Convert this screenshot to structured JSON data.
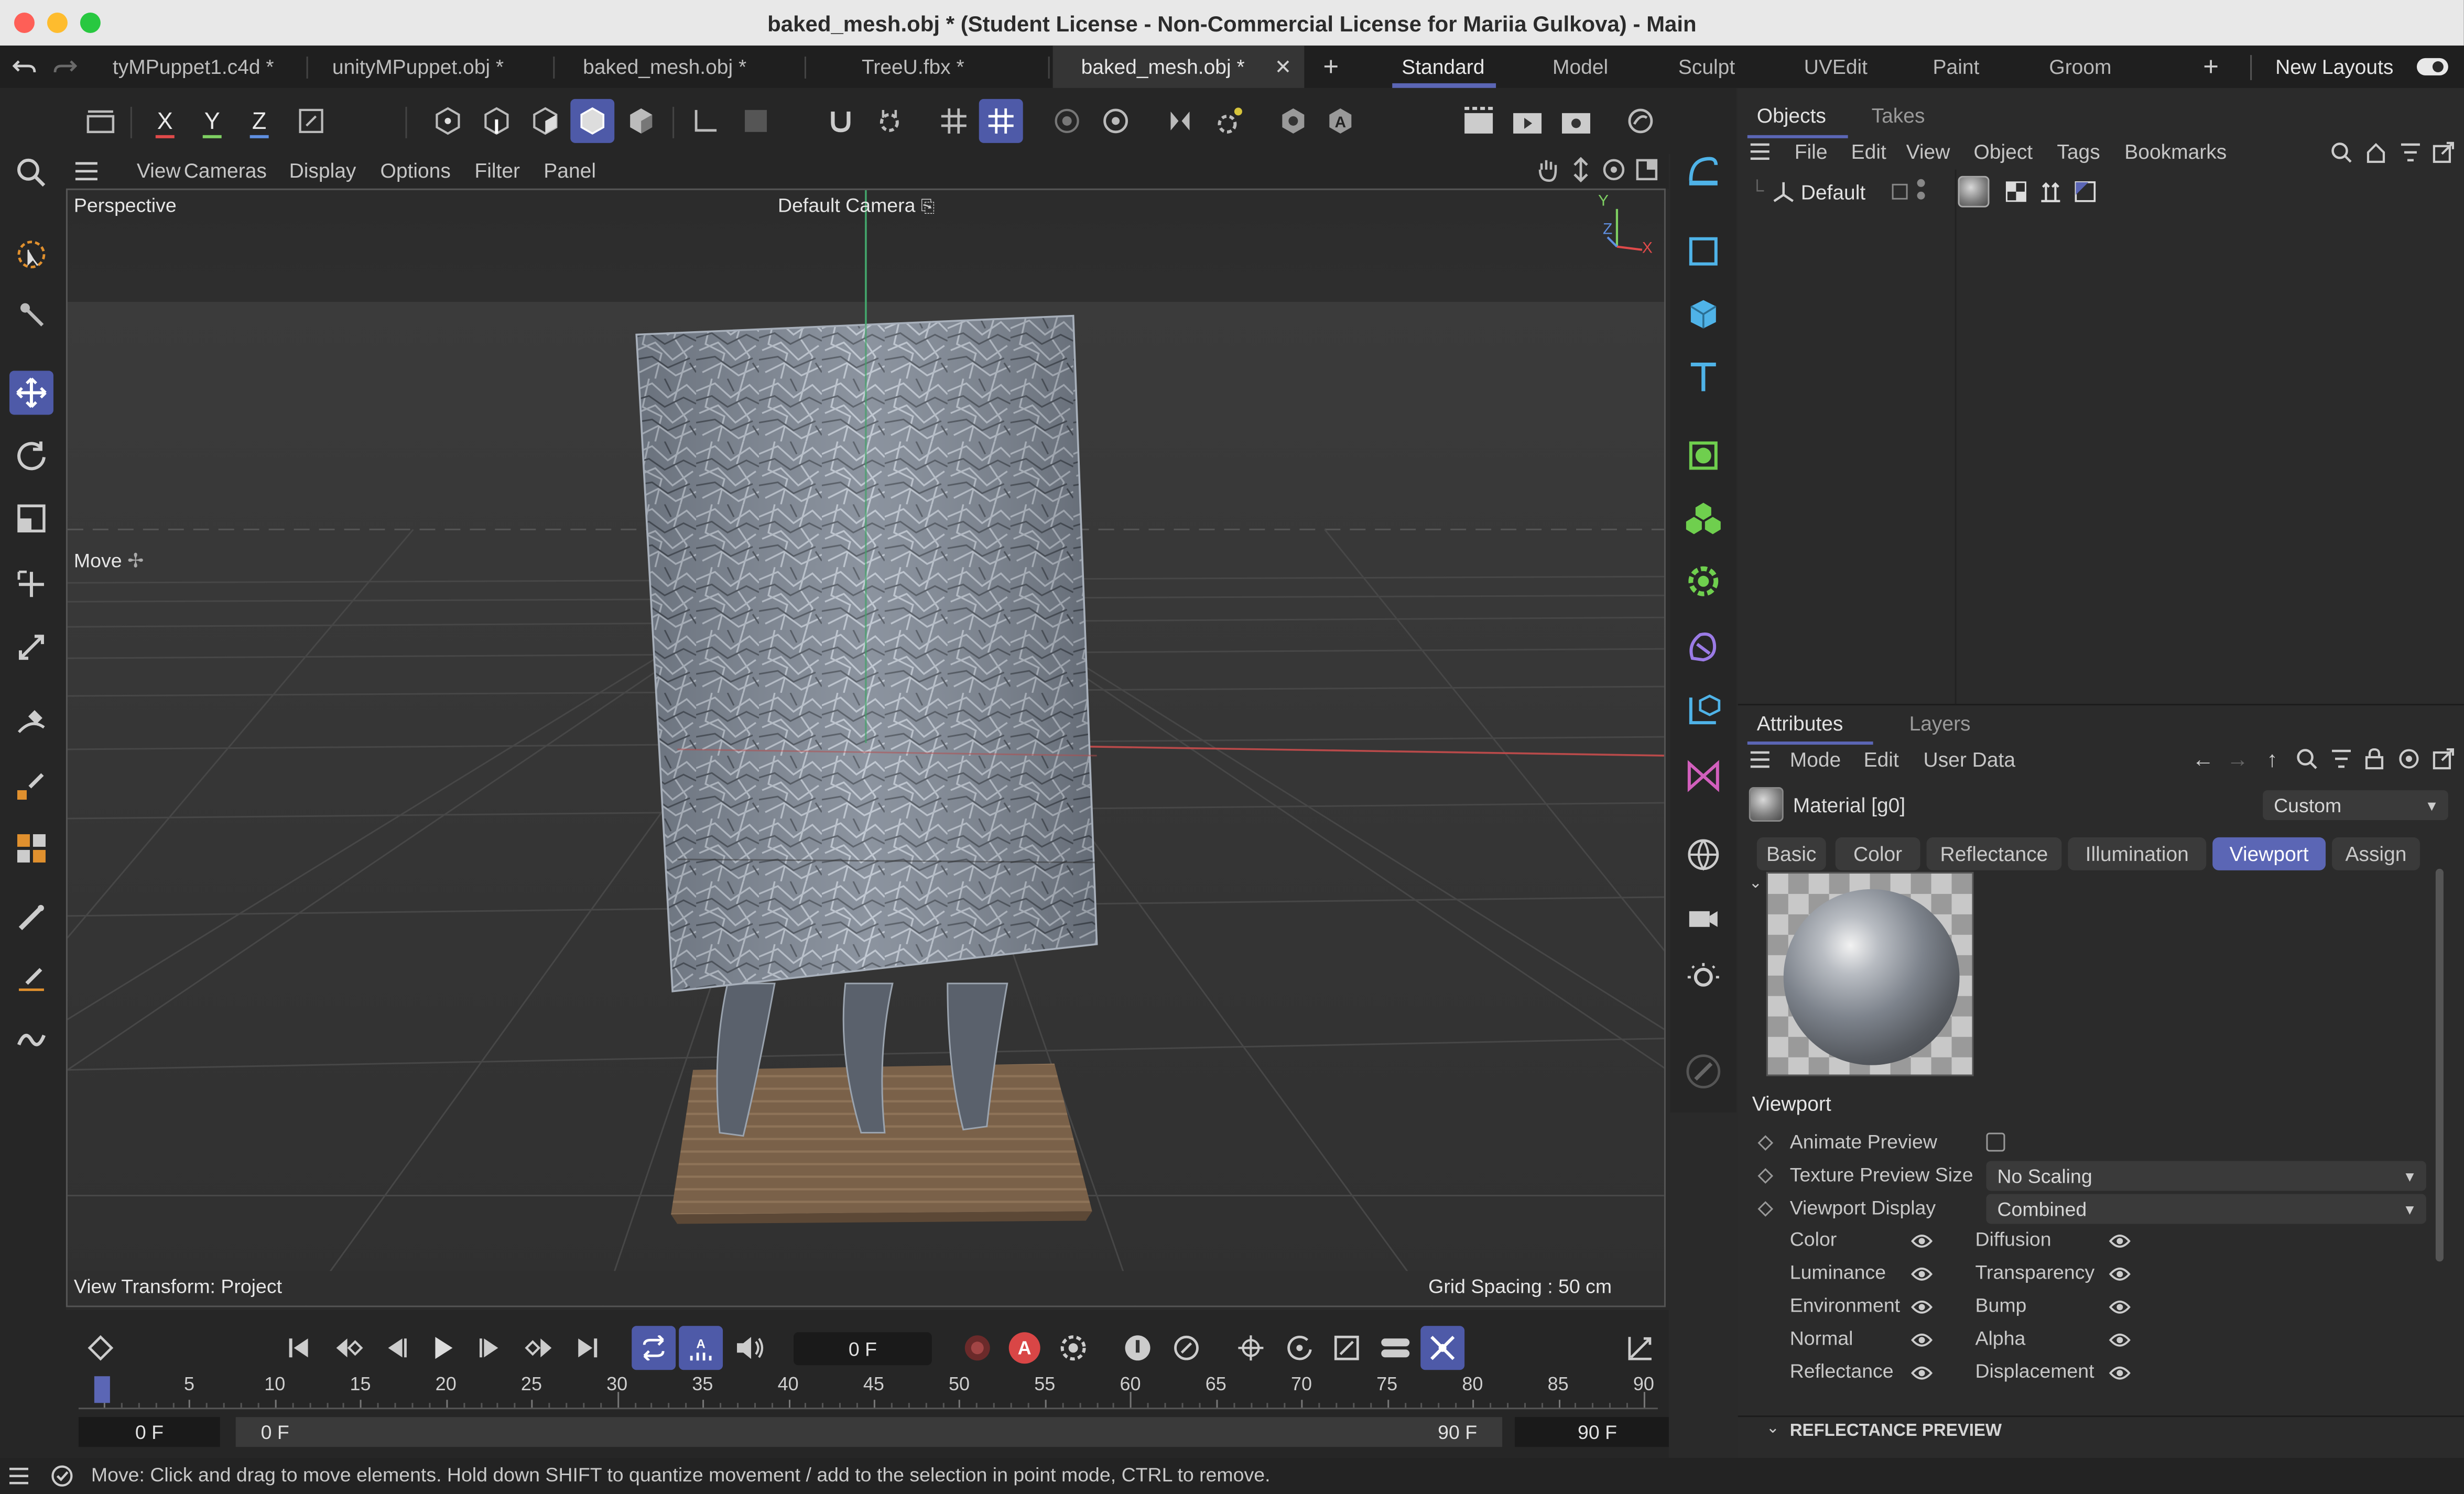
{
  "window": {
    "title": "baked_mesh.obj * (Student License - Non-Commercial License for Mariia Gulkova) - Main"
  },
  "doc_tabs": [
    {
      "label": "tyMPuppet1.c4d *",
      "active": false
    },
    {
      "label": "unityMPuppet.obj *",
      "active": false
    },
    {
      "label": "baked_mesh.obj *",
      "active": false
    },
    {
      "label": "TreeU.fbx *",
      "active": false
    },
    {
      "label": "baked_mesh.obj *",
      "active": true
    }
  ],
  "layouts": {
    "items": [
      "Standard",
      "Model",
      "Sculpt",
      "UVEdit",
      "Paint",
      "Groom"
    ],
    "active": "Standard",
    "new_layouts": "New Layouts"
  },
  "viewport_menu": [
    "View",
    "Cameras",
    "Display",
    "Options",
    "Filter",
    "Panel"
  ],
  "viewport": {
    "view_name": "Perspective",
    "camera": "Default Camera",
    "move_label": "Move",
    "view_transform": "View Transform: Project",
    "grid_spacing": "Grid Spacing : 50 cm",
    "axis_y": "Y",
    "axis_z": "Z",
    "axis_x": "X"
  },
  "coord_buttons": {
    "x": "X",
    "y": "Y",
    "z": "Z"
  },
  "timeline": {
    "current_frame": "0 F",
    "ticks": [
      "0",
      "5",
      "10",
      "15",
      "20",
      "25",
      "30",
      "35",
      "40",
      "45",
      "50",
      "55",
      "60",
      "65",
      "70",
      "75",
      "80",
      "85",
      "90"
    ],
    "start_field": "0 F",
    "range_start": "0 F",
    "range_end": "90 F",
    "end_field": "90 F",
    "autokey_label": "A"
  },
  "objects_panel": {
    "tabs": [
      "Objects",
      "Takes"
    ],
    "active_tab": "Objects",
    "menu": [
      "File",
      "Edit",
      "View",
      "Object",
      "Tags",
      "Bookmarks"
    ],
    "tree": [
      {
        "name": "Default"
      }
    ]
  },
  "attributes_panel": {
    "tabs": [
      "Attributes",
      "Layers"
    ],
    "active_tab": "Attributes",
    "menu": [
      "Mode",
      "Edit",
      "User Data"
    ],
    "material_name": "Material [g0]",
    "preset": "Custom",
    "channel_tabs": [
      "Basic",
      "Color",
      "Reflectance",
      "Illumination",
      "Viewport",
      "Assign"
    ],
    "active_channel": "Viewport",
    "section_title": "Viewport",
    "props": {
      "animate_preview": {
        "label": "Animate Preview",
        "checked": false
      },
      "texture_preview_size": {
        "label": "Texture Preview Size",
        "value": "No Scaling"
      },
      "viewport_display": {
        "label": "Viewport Display",
        "value": "Combined"
      }
    },
    "channels_left": [
      "Color",
      "Luminance",
      "Environment",
      "Normal",
      "Reflectance"
    ],
    "channels_right": [
      "Diffusion",
      "Transparency",
      "Bump",
      "Alpha",
      "Displacement"
    ],
    "reflectance_preview": "REFLECTANCE PREVIEW"
  },
  "status": {
    "message": "Move: Click and drag to move elements. Hold down SHIFT to quantize movement / add to the selection in point mode, CTRL to remove."
  },
  "colors": {
    "accent": "#5b66b5",
    "x_axis": "#e04a4a",
    "y_axis": "#7ecf62",
    "z_axis": "#5f8fe0",
    "icon_blue": "#4fb3e8",
    "icon_green": "#6fcf4e",
    "icon_purple": "#9b7be6",
    "icon_orange": "#e0902e"
  }
}
